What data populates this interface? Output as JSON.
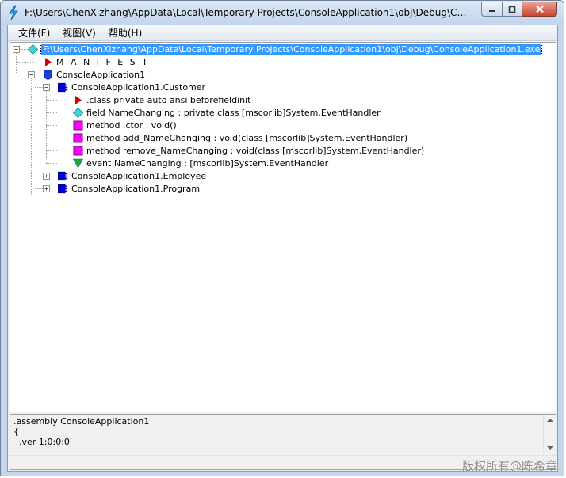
{
  "window": {
    "title": "F:\\Users\\ChenXizhang\\AppData\\Local\\Temporary Projects\\ConsoleApplication1\\obj\\Debug\\ConsoleAppl..."
  },
  "menu": [
    "文件(F)",
    "视图(V)",
    "帮助(H)"
  ],
  "tree": {
    "root_label": "F:\\Users\\ChenXizhang\\AppData\\Local\\Temporary Projects\\ConsoleApplication1\\obj\\Debug\\ConsoleApplication1.exe",
    "manifest_label": "M A N I F E S T",
    "namespace_label": "ConsoleApplication1",
    "class_customer_label": "ConsoleApplication1.Customer",
    "members": [
      ".class private auto ansi beforefieldinit",
      "field NameChanging : private class [mscorlib]System.EventHandler",
      "method .ctor : void()",
      "method add_NameChanging : void(class [mscorlib]System.EventHandler)",
      "method remove_NameChanging : void(class [mscorlib]System.EventHandler)",
      "event NameChanging : [mscorlib]System.EventHandler"
    ],
    "class_employee_label": "ConsoleApplication1.Employee",
    "class_program_label": "ConsoleApplication1.Program",
    "expander_expanded": "−",
    "expander_collapsed": "+"
  },
  "il_code": [
    ".assembly ConsoleApplication1",
    "{",
    "  .ver 1:0:0:0"
  ],
  "watermark": "版权所有@陈希章",
  "colors": {
    "selection": "#3399ff",
    "manifest_red": "#d40000",
    "class_blue": "#0000e0",
    "method_magenta": "#ff00ff",
    "field_cyan": "#22c6c6",
    "event_green": "#22a44a"
  }
}
